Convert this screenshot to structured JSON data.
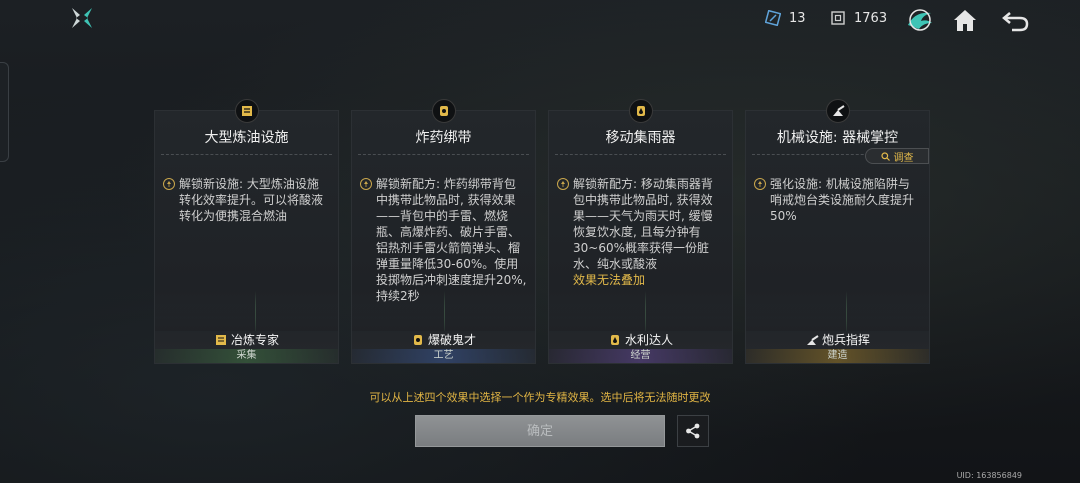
{
  "topbar": {
    "ticket_count": "13",
    "coin_count": "1763",
    "icons": [
      "logo-icon",
      "ticket-icon",
      "coin-icon",
      "bird-icon",
      "home-icon",
      "back-icon"
    ]
  },
  "cards": [
    {
      "title": "大型炼油设施",
      "body": "解锁新设施: 大型炼油设施转化效率提升。可以将酸液转化为便携混合燃油",
      "note": "",
      "skill": "冶炼专家",
      "type": "采集",
      "type_color": "#3e6a45"
    },
    {
      "title": "炸药绑带",
      "body": "解锁新配方: 炸药绑带背包中携带此物品时, 获得效果——背包中的手雷、燃烧瓶、高爆炸药、破片手雷、铝热剂手雷火箭筒弹头、榴弹重量降低30-60%。使用投掷物后冲刺速度提升20%, 持续2秒",
      "note": "",
      "skill": "爆破鬼才",
      "type": "工艺",
      "type_color": "#32466e"
    },
    {
      "title": "移动集雨器",
      "body": "解锁新配方: 移动集雨器背包中携带此物品时, 获得效果——天气为雨天时, 缓慢恢复饮水度, 且每分钟有30~60%概率获得一份脏水、纯水或酸液",
      "note": "效果无法叠加",
      "skill": "水利达人",
      "type": "经营",
      "type_color": "#4b3c6e"
    },
    {
      "title": "机械设施: 器械掌控",
      "body": "强化设施: 机械设施陷阱与哨戒炮台类设施耐久度提升50%",
      "note": "",
      "skill": "炮兵指挥",
      "type": "建造",
      "type_color": "#6e5a28",
      "investigate_label": "调查"
    }
  ],
  "hint": "可以从上述四个效果中选择一个作为专精效果。选中后将无法随时更改",
  "confirm_label": "确定",
  "uid": "UID: 163856849",
  "accent_color": "#e2b94a"
}
